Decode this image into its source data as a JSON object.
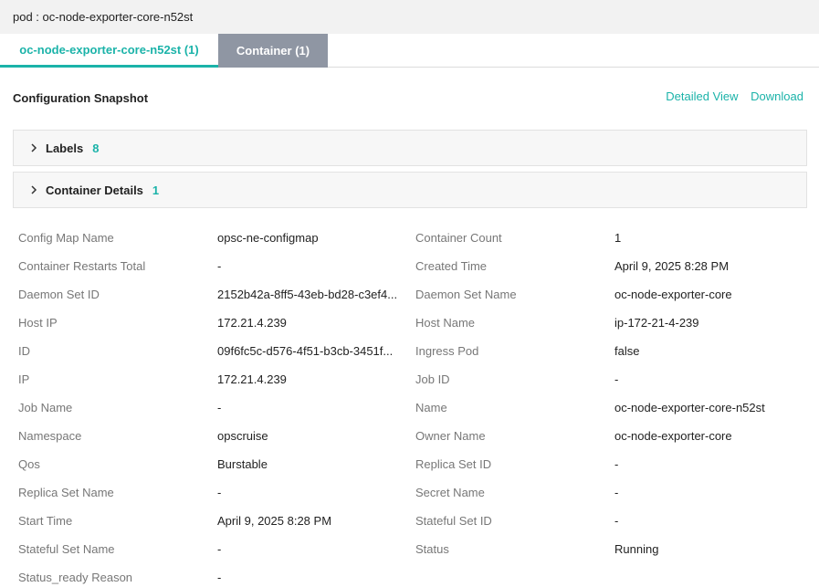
{
  "header": {
    "title": "pod : oc-node-exporter-core-n52st"
  },
  "tabs": [
    {
      "label": "oc-node-exporter-core-n52st (1)"
    },
    {
      "label": "Container (1)"
    }
  ],
  "snapshot": {
    "title": "Configuration Snapshot",
    "detailed_view": "Detailed View",
    "download": "Download"
  },
  "sections": [
    {
      "label": "Labels",
      "count": "8"
    },
    {
      "label": "Container Details",
      "count": "1"
    }
  ],
  "properties": [
    [
      "Config Map Name",
      "opsc-ne-configmap",
      "Container Count",
      "1"
    ],
    [
      "Container Restarts Total",
      "-",
      "Created Time",
      "April 9, 2025 8:28 PM"
    ],
    [
      "Daemon Set ID",
      "2152b42a-8ff5-43eb-bd28-c3ef4...",
      "Daemon Set Name",
      "oc-node-exporter-core"
    ],
    [
      "Host IP",
      "172.21.4.239",
      "Host Name",
      "ip-172-21-4-239"
    ],
    [
      "ID",
      "09f6fc5c-d576-4f51-b3cb-3451f...",
      "Ingress Pod",
      "false"
    ],
    [
      "IP",
      "172.21.4.239",
      "Job ID",
      "-"
    ],
    [
      "Job Name",
      "-",
      "Name",
      "oc-node-exporter-core-n52st"
    ],
    [
      "Namespace",
      "opscruise",
      "Owner Name",
      "oc-node-exporter-core"
    ],
    [
      "Qos",
      "Burstable",
      "Replica Set ID",
      "-"
    ],
    [
      "Replica Set Name",
      "-",
      "Secret Name",
      "-"
    ],
    [
      "Start Time",
      "April 9, 2025 8:28 PM",
      "Stateful Set ID",
      "-"
    ],
    [
      "Stateful Set Name",
      "-",
      "Status",
      "Running"
    ],
    [
      "Status_ready Reason",
      "-",
      "",
      ""
    ]
  ],
  "colors": {
    "accent": "#1bb3a9",
    "inactive_tab": "#8f96a3"
  },
  "icons": {
    "section_toggle": "chevron-right-icon"
  }
}
